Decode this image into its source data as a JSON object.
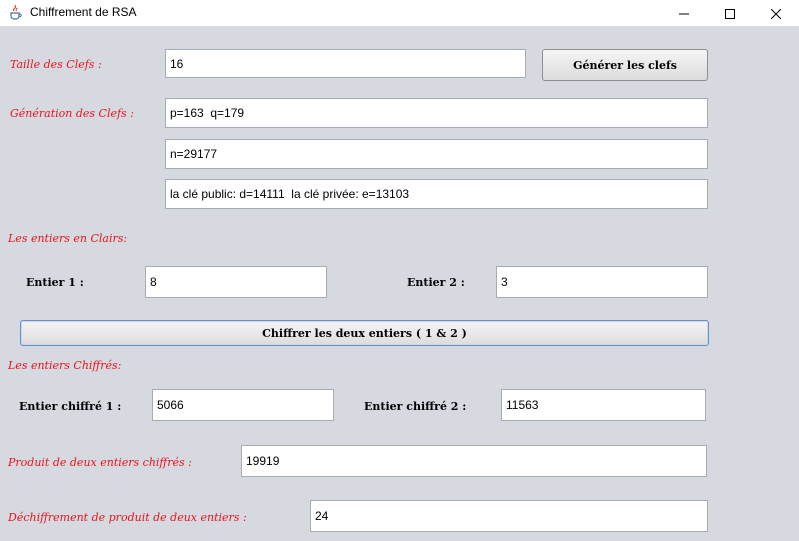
{
  "window": {
    "title": "Chiffrement de RSA"
  },
  "keygen": {
    "size_label": "Taille des Clefs :",
    "size_value": "16",
    "generate_button": "Générer les clefs",
    "generation_label": "Génération des Clefs :",
    "pq_value": "p=163  q=179",
    "n_value": "n=29177",
    "keys_value": "la clé public: d=14111  la clé privée: e=13103"
  },
  "plain": {
    "section_label": "Les entiers en Clairs:",
    "entier1_label": "Entier 1 :",
    "entier1_value": "8",
    "entier2_label": "Entier 2 :",
    "entier2_value": "3",
    "encrypt_button": "Chiffrer les deux entiers ( 1 & 2 )"
  },
  "cipher": {
    "section_label": "Les entiers Chiffrés:",
    "c1_label": "Entier chiffré 1 :",
    "c1_value": "5066",
    "c2_label": "Entier chiffré 2 :",
    "c2_value": "11563",
    "product_label": "Produit de deux entiers chiffrés :",
    "product_value": "19919",
    "decrypt_label": "Déchiffrement de produit de deux entiers :",
    "decrypt_value": "24"
  },
  "colors": {
    "label_red": "#e8141e",
    "background": "#d6d9df"
  },
  "icons": {
    "app": "java-cup-icon",
    "minimize": "minimize-icon",
    "maximize": "maximize-icon",
    "close": "close-icon"
  }
}
